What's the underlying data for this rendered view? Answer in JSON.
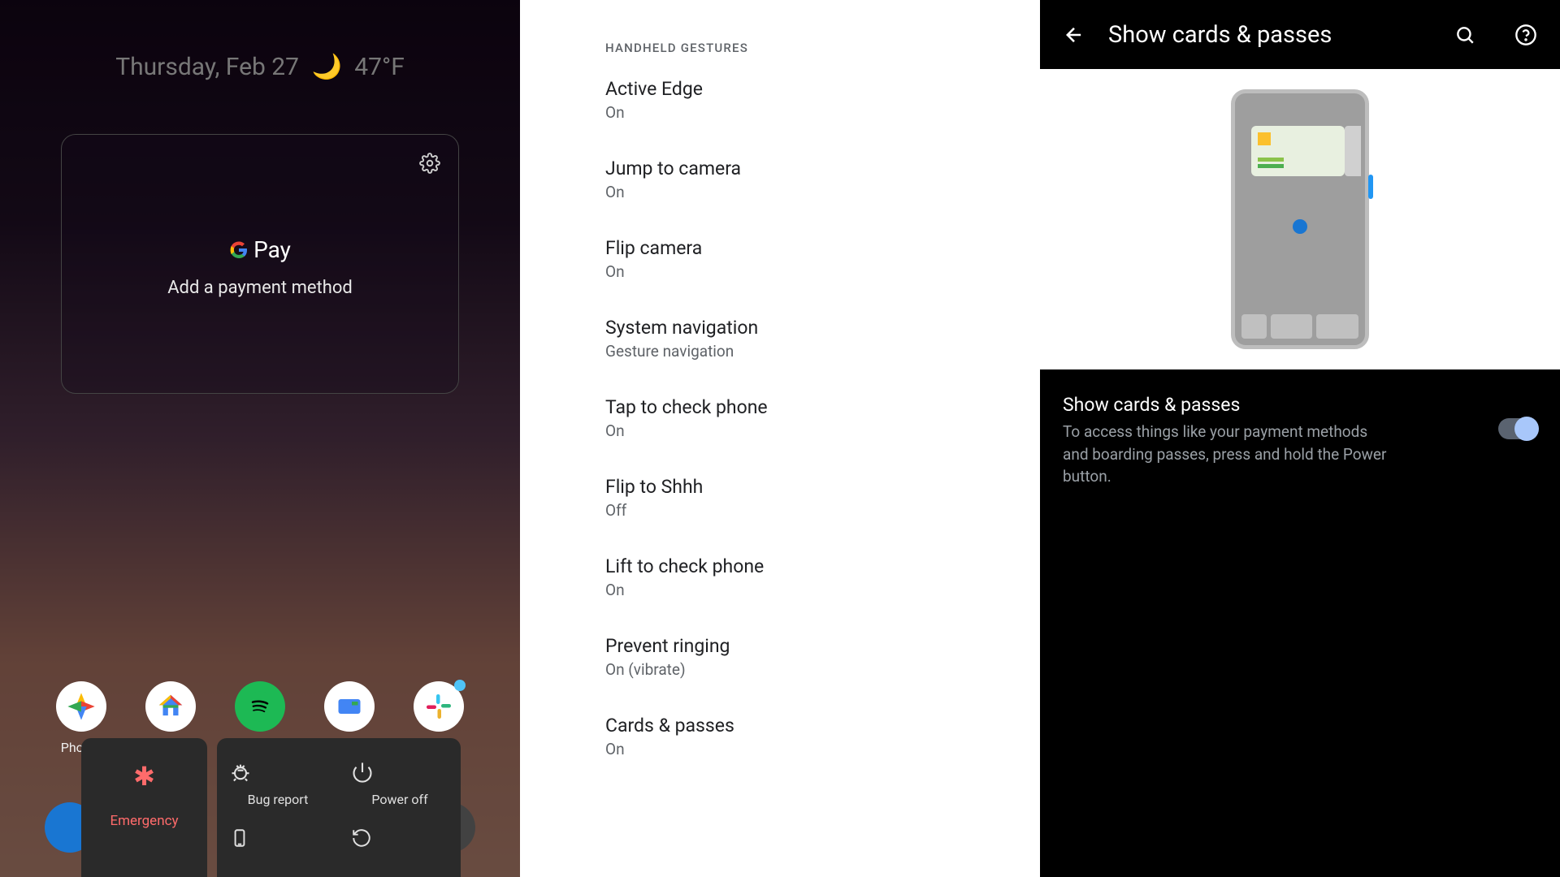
{
  "panel1": {
    "date": "Thursday, Feb 27",
    "temp": "47°F",
    "gpay": {
      "brand": "Pay",
      "sub": "Add a payment method"
    },
    "dock": [
      {
        "label": "Photos"
      },
      {
        "label": "Home"
      },
      {
        "label": "Spotify"
      },
      {
        "label": "Skit"
      },
      {
        "label": "Slack"
      }
    ],
    "power": {
      "emergency": "Emergency",
      "items": [
        {
          "label": "Bug report"
        },
        {
          "label": "Power off"
        }
      ]
    }
  },
  "panel2": {
    "section": "HANDHELD GESTURES",
    "settings": [
      {
        "title": "Active Edge",
        "sub": "On"
      },
      {
        "title": "Jump to camera",
        "sub": "On"
      },
      {
        "title": "Flip camera",
        "sub": "On"
      },
      {
        "title": "System navigation",
        "sub": "Gesture navigation"
      },
      {
        "title": "Tap to check phone",
        "sub": "On"
      },
      {
        "title": "Flip to Shhh",
        "sub": "Off"
      },
      {
        "title": "Lift to check phone",
        "sub": "On"
      },
      {
        "title": "Prevent ringing",
        "sub": "On (vibrate)"
      },
      {
        "title": "Cards & passes",
        "sub": "On"
      }
    ]
  },
  "panel3": {
    "title": "Show cards & passes",
    "setting": {
      "title": "Show cards & passes",
      "sub": "To access things like your payment methods and boarding passes, press and hold the Power button."
    }
  }
}
